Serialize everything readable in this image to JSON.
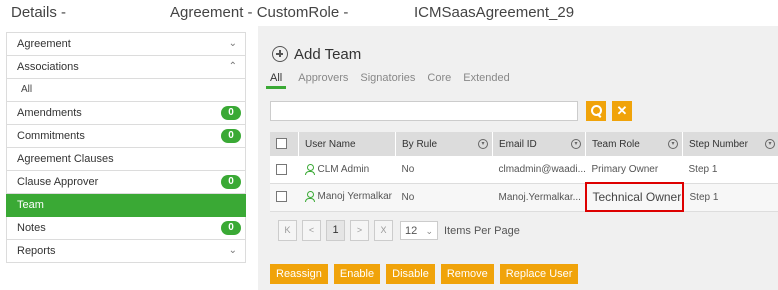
{
  "header": {
    "details": "Details -",
    "agreement": "Agreement - CustomRole -",
    "name": "ICMSaasAgreement_29"
  },
  "sidebar": {
    "items": [
      {
        "label": "Agreement",
        "chevron": "chevron-down-icon"
      },
      {
        "label": "Associations",
        "chevron": "chevron-up-icon"
      },
      {
        "label": "All"
      },
      {
        "label": "Amendments",
        "count": "0"
      },
      {
        "label": "Commitments",
        "count": "0"
      },
      {
        "label": "Agreement Clauses"
      },
      {
        "label": "Clause Approver",
        "count": "0"
      },
      {
        "label": "Team",
        "active": true
      },
      {
        "label": "Notes",
        "count": "0"
      },
      {
        "label": "Reports",
        "chevron": "chevron-down-icon"
      }
    ]
  },
  "main": {
    "add_team": "Add Team",
    "tabs": [
      "All",
      "Approvers",
      "Signatories",
      "Core",
      "Extended"
    ],
    "clear_symbol": "✕",
    "columns": [
      "User Name",
      "By Rule",
      "Email ID",
      "Team Role",
      "Step Number"
    ],
    "rows": [
      {
        "user": "CLM Admin",
        "by_rule": "No",
        "email": "clmadmin@waadi...",
        "role": "Primary Owner",
        "step": "Step 1"
      },
      {
        "user": "Manoj Yermalkar",
        "by_rule": "No",
        "email": "Manoj.Yermalkar...",
        "role": "Technical Owner",
        "step": "Step 1"
      }
    ],
    "pager": {
      "first": "K",
      "prev": "<",
      "page": "1",
      "next": ">",
      "last": "X",
      "per_page": "12",
      "per_page_label": "Items Per Page"
    },
    "actions": [
      "Reassign",
      "Enable",
      "Disable",
      "Remove",
      "Replace User"
    ]
  },
  "colors": {
    "accent": "#3aa935",
    "button": "#f0a30a",
    "highlight": "#dd0000"
  }
}
